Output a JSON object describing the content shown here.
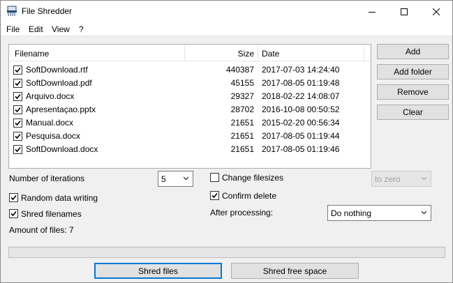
{
  "window": {
    "title": "File Shredder",
    "controls": [
      "minimize",
      "maximize",
      "close"
    ]
  },
  "menu": [
    "File",
    "Edit",
    "View",
    "?"
  ],
  "file_list": {
    "columns": [
      "Filename",
      "Size",
      "Date"
    ],
    "rows": [
      {
        "checked": true,
        "name": "SoftDownload.rtf",
        "size": "440387",
        "date": "2017-07-03 14:24:40"
      },
      {
        "checked": true,
        "name": "SoftDownload.pdf",
        "size": "45155",
        "date": "2017-08-05 01:19:48"
      },
      {
        "checked": true,
        "name": "Arquivo.docx",
        "size": "29327",
        "date": "2018-02-22 14:08:07"
      },
      {
        "checked": true,
        "name": "Apresentaçao.pptx",
        "size": "28702",
        "date": "2016-10-08 00:50:52"
      },
      {
        "checked": true,
        "name": "Manual.docx",
        "size": "21651",
        "date": "2015-02-20 00:56:34"
      },
      {
        "checked": true,
        "name": "Pesquisa.docx",
        "size": "21651",
        "date": "2017-08-05 01:19:44"
      },
      {
        "checked": true,
        "name": "SoftDownload.docx",
        "size": "21651",
        "date": "2017-08-05 01:19:46"
      }
    ]
  },
  "side_buttons": {
    "add": "Add",
    "add_folder": "Add folder",
    "remove": "Remove",
    "clear": "Clear"
  },
  "options": {
    "iterations_label": "Number of iterations",
    "iterations_value": "5",
    "random_data_label": "Random data writing",
    "random_data_checked": true,
    "shred_filenames_label": "Shred filenames",
    "shred_filenames_checked": true,
    "change_filesizes_label": "Change filesizes",
    "change_filesizes_checked": false,
    "filesize_mode_value": "to zero",
    "confirm_delete_label": "Confirm delete",
    "confirm_delete_checked": true,
    "after_processing_label": "After processing:",
    "after_processing_value": "Do nothing"
  },
  "status": {
    "amount_of_files": "Amount of files: 7"
  },
  "progress": 0,
  "bottom_buttons": {
    "shred_files": "Shred files",
    "shred_free_space": "Shred free space"
  }
}
